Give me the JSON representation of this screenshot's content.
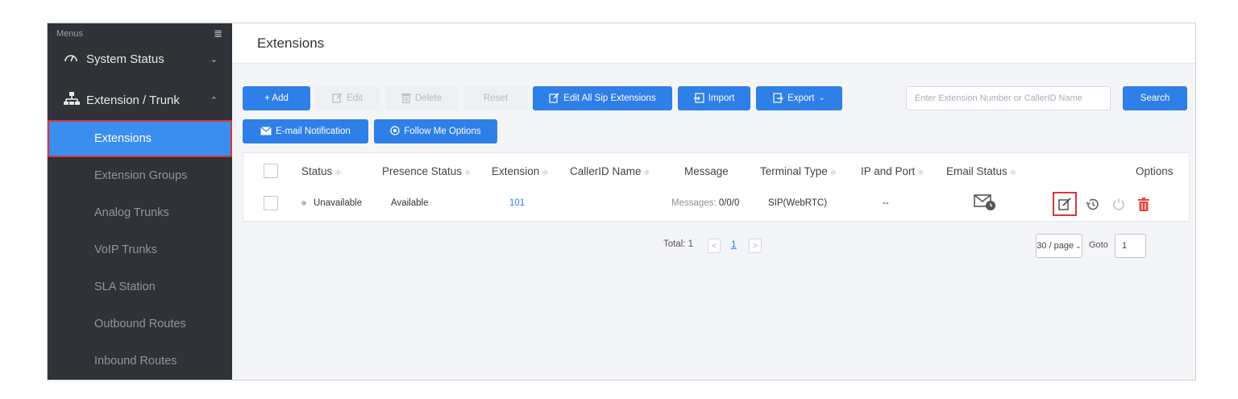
{
  "sidebar": {
    "menus_label": "Menus",
    "toggle_icon": "≣",
    "groups": [
      {
        "label": "System Status",
        "icon": "gauge-icon",
        "chevron": "⌄"
      },
      {
        "label": "Extension / Trunk",
        "icon": "network-icon",
        "chevron": "⌃"
      }
    ],
    "items": [
      {
        "label": "Extensions",
        "active": true
      },
      {
        "label": "Extension Groups"
      },
      {
        "label": "Analog Trunks"
      },
      {
        "label": "VoIP Trunks"
      },
      {
        "label": "SLA Station"
      },
      {
        "label": "Outbound Routes"
      },
      {
        "label": "Inbound Routes"
      }
    ]
  },
  "page": {
    "title": "Extensions"
  },
  "toolbar": {
    "add": "+ Add",
    "edit": "Edit",
    "delete": "Delete",
    "reset": "Reset",
    "edit_all": "Edit All Sip Extensions",
    "import": "Import",
    "export": "Export",
    "search_placeholder": "Enter Extension Number or CallerID Name",
    "search": "Search",
    "email_notification": "E-mail Notification",
    "follow_me": "Follow Me Options"
  },
  "table": {
    "headers": {
      "status": "Status",
      "presence": "Presence Status",
      "extension": "Extension",
      "callerid": "CallerID Name",
      "message": "Message",
      "terminal": "Terminal Type",
      "ip_port": "IP and Port",
      "email_status": "Email Status",
      "options": "Options"
    },
    "sort_glyph": "≑",
    "rows": [
      {
        "status": "Unavailable",
        "presence": "Available",
        "extension": "101",
        "callerid": "",
        "message_label": "Messages:",
        "message_value": "0/0/0",
        "terminal": "SIP(WebRTC)",
        "ip_port": "--"
      }
    ]
  },
  "pagination": {
    "total": "Total: 1",
    "prev": "<",
    "page": "1",
    "next": ">",
    "per_page": "30 / page",
    "goto_label": "Goto",
    "goto_value": "1"
  },
  "colors": {
    "accent": "#2f7fe8",
    "sidebar_bg": "#2f3237",
    "active_item": "#3a8ef0",
    "highlight_border": "#d9363e",
    "delete_red": "#e8453c"
  }
}
